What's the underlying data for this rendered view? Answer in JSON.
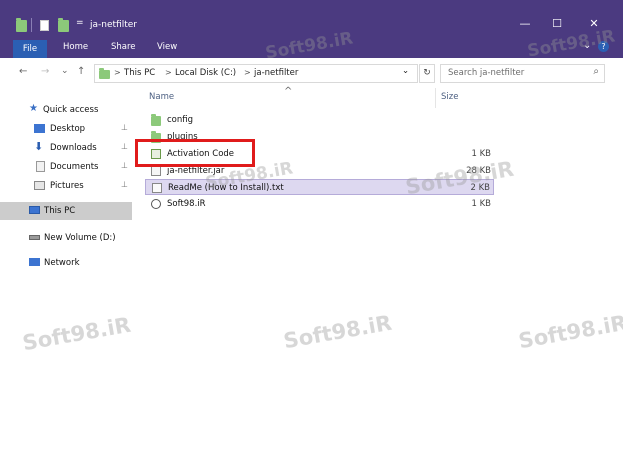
{
  "window": {
    "title": "ja-netfilter",
    "controls": {
      "minimize": "—",
      "maximize": "☐",
      "close": "✕"
    }
  },
  "ribbon": {
    "tabs": [
      "File",
      "Home",
      "Share",
      "View"
    ],
    "expand": "⌄",
    "help": "?"
  },
  "address": {
    "back": "←",
    "forward": "→",
    "recent": "⌄",
    "up": "↑",
    "crumbs": [
      "This PC",
      "Local Disk (C:)",
      "ja-netfilter"
    ],
    "separator": ">",
    "dropdown": "⌄",
    "refresh": "↻",
    "search_placeholder": "Search ja-netfilter",
    "search_icon": "⌕"
  },
  "nav_pane": {
    "items": [
      {
        "label": "Quick access",
        "icon": "star-icon"
      },
      {
        "label": "Desktop",
        "icon": "desktop-icon",
        "pin": "📌"
      },
      {
        "label": "Downloads",
        "icon": "download-icon",
        "pin": "📌"
      },
      {
        "label": "Documents",
        "icon": "documents-icon",
        "pin": "📌"
      },
      {
        "label": "Pictures",
        "icon": "pictures-icon",
        "pin": "📌"
      },
      {
        "label": "This PC",
        "icon": "computer-icon",
        "selected": true
      },
      {
        "label": "New Volume (D:)",
        "icon": "drive-icon"
      },
      {
        "label": "Network",
        "icon": "network-icon"
      }
    ]
  },
  "file_list": {
    "columns": {
      "name": "Name",
      "size": "Size"
    },
    "sort_indicator": "^",
    "rows": [
      {
        "name": "config",
        "size": "",
        "icon": "folder-icon"
      },
      {
        "name": "plugins",
        "size": "",
        "icon": "folder-icon"
      },
      {
        "name": "Activation Code",
        "size": "1 KB",
        "icon": "text-file-icon"
      },
      {
        "name": "ja-netfilter.jar",
        "size": "28 KB",
        "icon": "jar-file-icon"
      },
      {
        "name": "ReadMe (How to Install).txt",
        "size": "2 KB",
        "icon": "text-file-icon",
        "selected": true
      },
      {
        "name": "Soft98.iR",
        "size": "1 KB",
        "icon": "shortcut-icon"
      }
    ]
  },
  "watermark": "Soft98.iR",
  "colors": {
    "titlebar": "#4b3a80",
    "file_tab": "#2b5fb3",
    "highlight_box": "#e01b1b",
    "selected_row": "#ddd8f0"
  }
}
